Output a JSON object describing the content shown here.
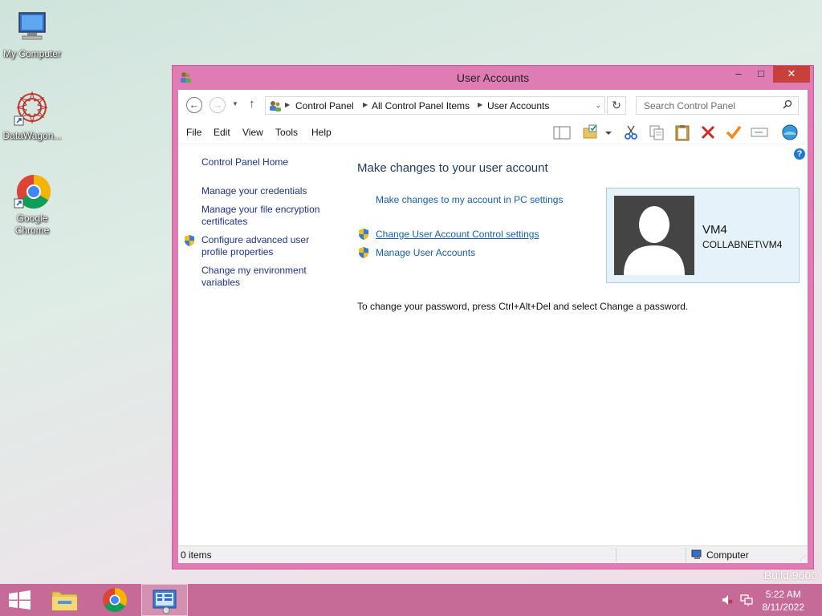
{
  "desktop": {
    "icons": [
      {
        "label": "My Computer"
      },
      {
        "label": "DataWagon..."
      },
      {
        "label": "Google Chrome"
      }
    ],
    "build_text": "Build 9600"
  },
  "window": {
    "title": "User Accounts",
    "controls": {
      "minimize": "–",
      "maximize": "□",
      "close": "✕"
    },
    "nav": {
      "back": "←",
      "forward": "→",
      "up": "↑",
      "refresh": "↻"
    },
    "breadcrumb": [
      "Control Panel",
      "All Control Panel Items",
      "User Accounts"
    ],
    "search": {
      "placeholder": "Search Control Panel"
    },
    "menu": [
      "File",
      "Edit",
      "View",
      "Tools",
      "Help"
    ],
    "left_pane": {
      "home": "Control Panel Home",
      "credentials": "Manage your credentials",
      "encryption": "Manage your file encryption certificates",
      "profile": "Configure advanced user profile properties",
      "environment": "Change my environment variables"
    },
    "main": {
      "title": "Make changes to your user account",
      "pc_settings_link": "Make changes to my account in PC settings",
      "uac_link": "Change User Account Control settings",
      "manage_link": "Manage User Accounts",
      "password_text": "To change your password, press Ctrl+Alt+Del and select Change a password.",
      "help": "?"
    },
    "user": {
      "name": "VM4",
      "domain": "COLLABNET\\VM4"
    },
    "status": {
      "items": "0 items",
      "location": "Computer"
    }
  },
  "taskbar": {
    "time": "5:22 AM",
    "date": "8/11/2022"
  },
  "colors": {
    "window_frame": "#e07cb4",
    "taskbar": "#c66b97",
    "link": "#1a5ea6",
    "title_text": "#1e395b",
    "close_button": "#c7413a"
  }
}
